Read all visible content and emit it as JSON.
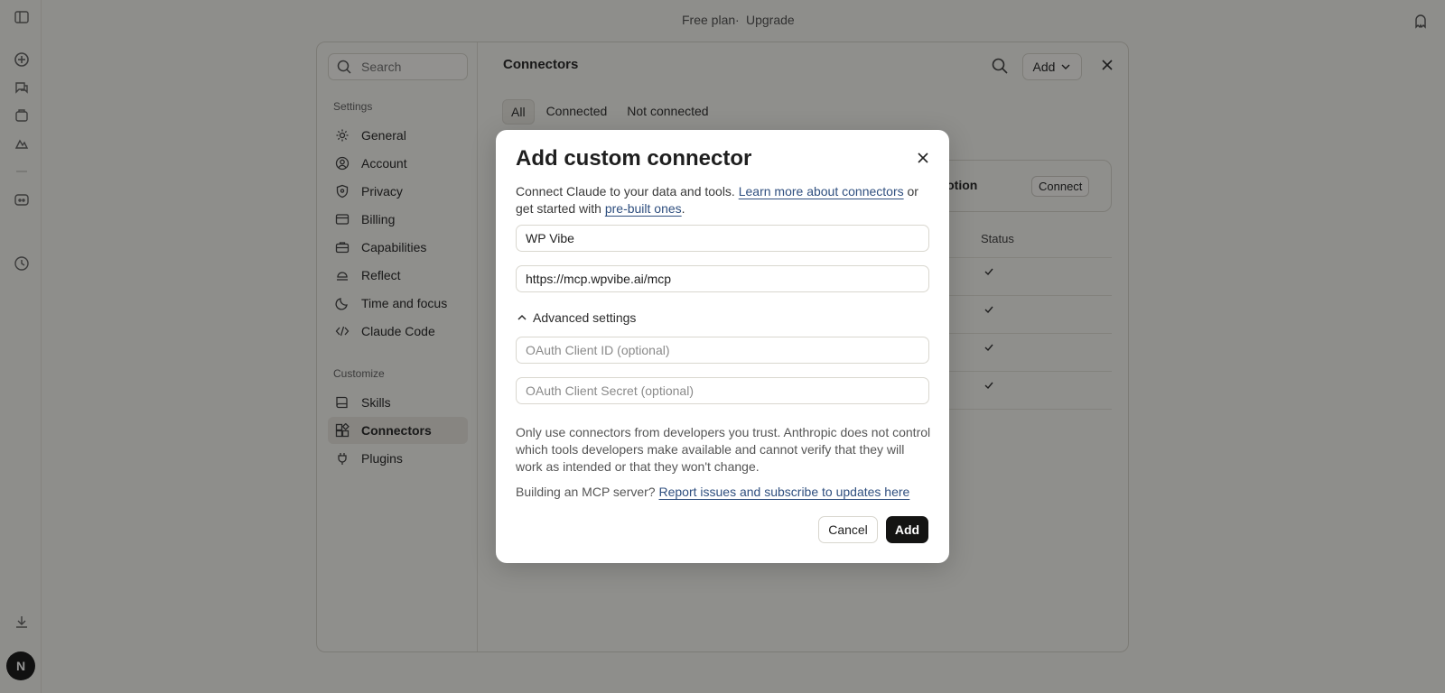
{
  "topbar": {
    "plan": "Free plan",
    "separator": "·",
    "upgrade": "Upgrade"
  },
  "user": {
    "avatar_initial": "N"
  },
  "settings": {
    "search_placeholder": "Search",
    "settings_heading": "Settings",
    "settings_items": [
      {
        "label": "General",
        "icon": "gear-icon"
      },
      {
        "label": "Account",
        "icon": "user-circle-icon"
      },
      {
        "label": "Privacy",
        "icon": "shield-icon"
      },
      {
        "label": "Billing",
        "icon": "credit-card-icon"
      },
      {
        "label": "Capabilities",
        "icon": "briefcase-icon"
      },
      {
        "label": "Reflect",
        "icon": "lamp-icon"
      },
      {
        "label": "Time and focus",
        "icon": "moon-icon"
      },
      {
        "label": "Claude Code",
        "icon": "code-icon"
      }
    ],
    "customize_heading": "Customize",
    "customize_items": [
      {
        "label": "Skills",
        "icon": "book-icon"
      },
      {
        "label": "Connectors",
        "icon": "grid-icon",
        "active": true
      },
      {
        "label": "Plugins",
        "icon": "plug-icon"
      }
    ]
  },
  "main": {
    "title": "Connectors",
    "add_label": "Add",
    "tabs": [
      {
        "label": "All",
        "active": true
      },
      {
        "label": "Connected"
      },
      {
        "label": "Not connected"
      }
    ],
    "notion": {
      "name": "Notion",
      "connect_label": "Connect"
    },
    "status_header": "Status",
    "status_rows": 4
  },
  "modal": {
    "title": "Add custom connector",
    "desc_prefix": "Connect Claude to your data and tools. ",
    "desc_link": "Learn more about connectors",
    "desc_mid": " or get started with ",
    "desc_link2": "pre-built ones",
    "desc_suffix": ".",
    "name_value": "WP Vibe",
    "url_value": "https://mcp.wpvibe.ai/mcp",
    "advanced_label": "Advanced settings",
    "client_id_placeholder": "OAuth Client ID (optional)",
    "client_secret_placeholder": "OAuth Client Secret (optional)",
    "warning": "Only use connectors from developers you trust. Anthropic does not control which tools developers make available and cannot verify that they will work as intended or that they won't change.",
    "mcp_prefix": "Building an MCP server? ",
    "mcp_link": "Report issues and subscribe to updates here",
    "cancel_label": "Cancel",
    "add_label": "Add"
  }
}
